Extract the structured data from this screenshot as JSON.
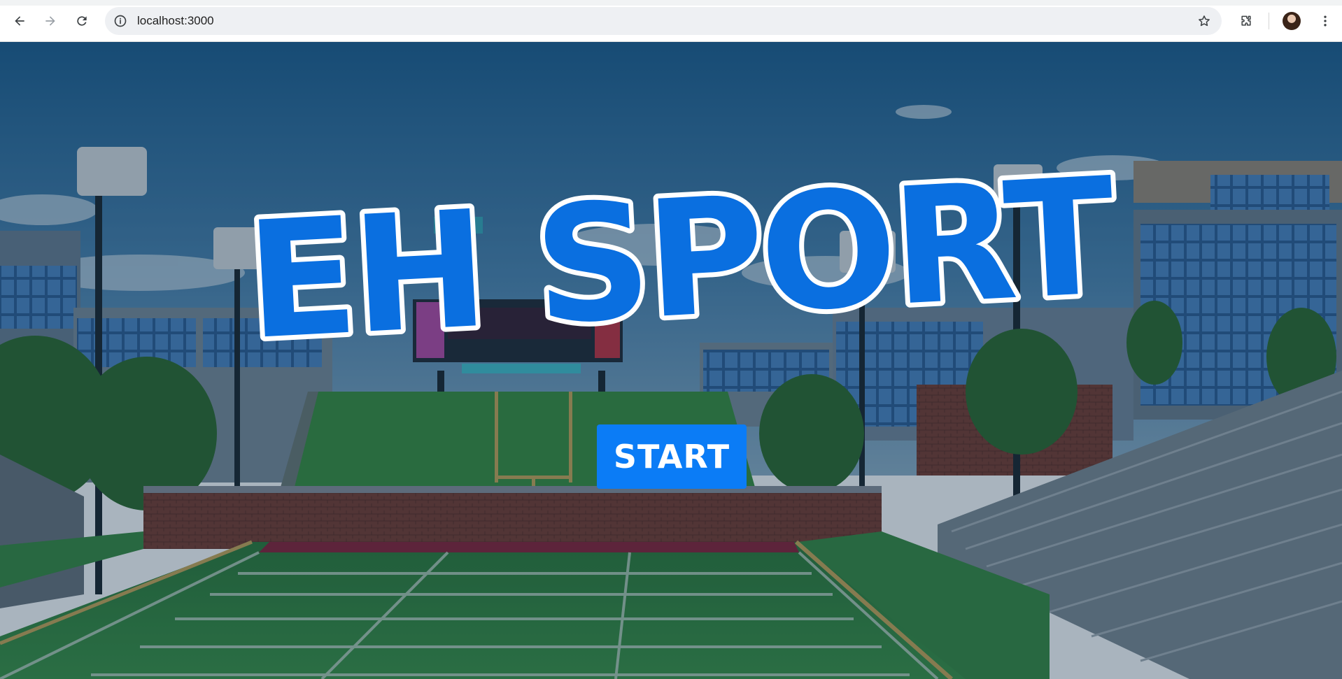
{
  "browser": {
    "url": "localhost:3000",
    "icons": {
      "back": "arrow-left-icon",
      "forward": "arrow-right-icon",
      "reload": "reload-icon",
      "site_info": "info-icon",
      "bookmark": "star-icon",
      "extensions": "puzzle-icon",
      "profile": "avatar",
      "menu": "kebab-menu-icon"
    }
  },
  "game": {
    "title": "EH SPORT",
    "start_label": "START",
    "colors": {
      "title_fill": "#0a6fe0",
      "title_outline": "#ffffff",
      "button": "#0b7cf6",
      "overlay": "rgba(10,40,70,0.35)"
    }
  }
}
